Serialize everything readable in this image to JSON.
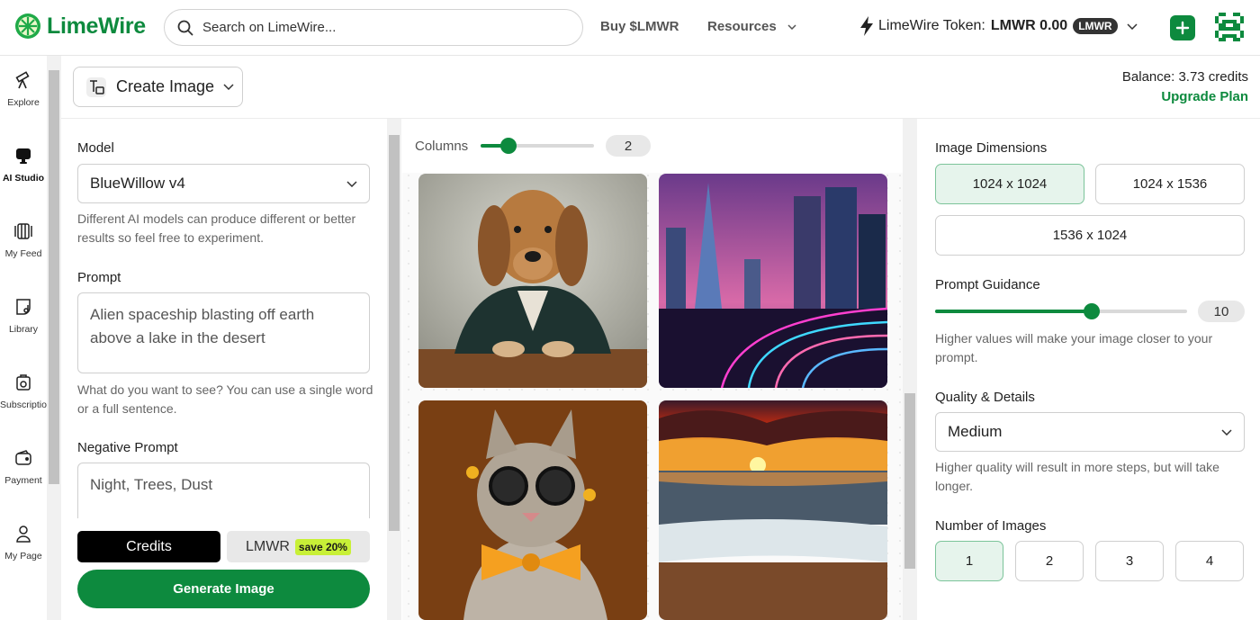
{
  "header": {
    "brand": "LimeWire",
    "search_placeholder": "Search on LimeWire...",
    "buy_link": "Buy $LMWR",
    "resources_menu": "Resources",
    "token_label": "LimeWire Token:",
    "token_amount": "LMWR 0.00",
    "token_badge": "LMWR",
    "accent_color": "#0d8a3e"
  },
  "sidebar": {
    "items": [
      {
        "label": "Explore",
        "icon": "telescope-icon"
      },
      {
        "label": "AI Studio",
        "icon": "monitor-icon",
        "active": true
      },
      {
        "label": "My Feed",
        "icon": "feed-icon"
      },
      {
        "label": "Library",
        "icon": "library-icon"
      },
      {
        "label": "Subscriptio",
        "icon": "subscription-icon"
      },
      {
        "label": "Payment",
        "icon": "wallet-icon"
      },
      {
        "label": "My Page",
        "icon": "user-icon"
      }
    ]
  },
  "toolbar": {
    "mode": "Create Image",
    "balance": "Balance: 3.73 credits",
    "upgrade": "Upgrade Plan"
  },
  "settings": {
    "model_label": "Model",
    "model_value": "BlueWillow v4",
    "model_hint": "Different AI models can produce different or better results so feel free to experiment.",
    "prompt_label": "Prompt",
    "prompt_value": "Alien spaceship blasting off earth above a lake in the desert",
    "prompt_hint": "What do you want to see? You can use a single word or a full sentence.",
    "negative_label": "Negative Prompt",
    "negative_value": "Night, Trees, Dust",
    "pay_credits": "Credits",
    "pay_lmwr": "LMWR",
    "save_badge": "save 20%",
    "generate": "Generate Image"
  },
  "gallery": {
    "columns_label": "Columns",
    "columns_value": "2",
    "columns_slider_fraction": 0.25,
    "images": [
      {
        "subject": "dog in suit"
      },
      {
        "subject": "neon city"
      },
      {
        "subject": "cat with glasses and bow tie"
      },
      {
        "subject": "sunset over beach"
      }
    ]
  },
  "options": {
    "dimensions_label": "Image Dimensions",
    "dimensions": [
      "1024 x 1024",
      "1024 x 1536",
      "1536 x 1024"
    ],
    "dimensions_selected": 0,
    "guidance_label": "Prompt Guidance",
    "guidance_value": "10",
    "guidance_fraction": 0.62,
    "guidance_hint": "Higher values will make your image closer to your prompt.",
    "quality_label": "Quality & Details",
    "quality_value": "Medium",
    "quality_hint": "Higher quality will result in more steps, but will take longer.",
    "count_label": "Number of Images",
    "counts": [
      "1",
      "2",
      "3",
      "4"
    ],
    "count_selected": 0
  }
}
